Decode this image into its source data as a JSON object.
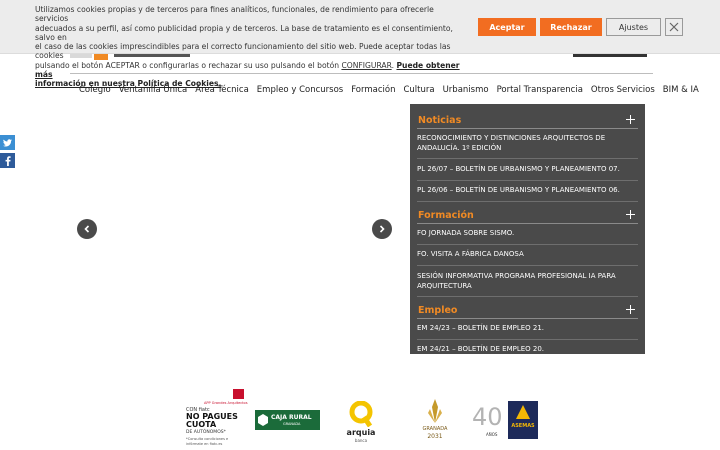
{
  "cookie_banner": {
    "line1": "Utilizamos cookies propias y de terceros para fines analíticos, funcionales, de rendimiento para ofrecerle servicios",
    "line2": "adecuados a su perfil, así como publicidad propia y de terceros. La base de tratamiento es el consentimiento, salvo en",
    "line3": "el caso de las cookies imprescindibles para el correcto funcionamiento del sitio web. Puede aceptar todas las cookies",
    "line4_pre": "pulsando el botón ACEPTAR o configurarlas o rechazar su uso pulsando el botón",
    "configure_link": "CONFIGURAR",
    "more_info_link_1": "Puede obtener más",
    "more_info_link_2": "información en nuestra Política de Cookies.",
    "accept_label": "Aceptar",
    "reject_label": "Rechazar",
    "settings_label": "Ajustes"
  },
  "nav": {
    "items": [
      "Colegio",
      "Ventanilla Única",
      "Área Técnica",
      "Empleo y Concursos",
      "Formación",
      "Cultura",
      "Urbanismo",
      "Portal Transparencia",
      "Otros Servicios",
      "BIM & IA"
    ]
  },
  "panel": {
    "sections": [
      {
        "title": "Noticias",
        "items": [
          "RECONOCIMIENTO Y DISTINCIONES ARQUITECTOS DE ANDALUCÍA. 1º EDICIÓN",
          "PL 26/07 – BOLETÍN DE URBANISMO Y PLANEAMIENTO 07.",
          "PL 26/06 – BOLETÍN DE URBANISMO Y PLANEAMIENTO 06."
        ]
      },
      {
        "title": "Formación",
        "items": [
          "FO JORNADA SOBRE SISMO.",
          "FO. VISITA A FÁBRICA DANOSA",
          "SESIÓN INFORMATIVA PROGRAMA PROFESIONAL IA PARA ARQUITECTURA"
        ]
      },
      {
        "title": "Empleo",
        "items": [
          "EM 24/23 – BOLETÍN DE EMPLEO 21.",
          "EM 24/21 – BOLETÍN DE EMPLEO 20."
        ]
      }
    ]
  },
  "sponsors": {
    "fiatc": {
      "line0": "APP Grandes Arquitectos",
      "line1": "CON fiatc",
      "line2": "NO PAGUES",
      "line3": "CUOTA",
      "line4": "DE AUTÓNOMOS*",
      "line5": "*Consulta condiciones e",
      "line6": "infórmate en fiatc.es"
    },
    "caja_rural": {
      "line1": "CAJA RURAL",
      "line2": "GRANADA"
    },
    "arquia": {
      "name": "arquia",
      "sub": "banca"
    },
    "granada2031": {
      "line1": "GRANADA",
      "line2": "2031"
    },
    "asemas": {
      "name": "ASEMAS",
      "years": "40",
      "sub": "AÑOS"
    }
  },
  "colors": {
    "accent": "#f26d21",
    "panel_bg": "#4a4a4a",
    "section_title": "#f08a24",
    "twitter": "#3b8fd3",
    "facebook": "#2e5b9a"
  }
}
